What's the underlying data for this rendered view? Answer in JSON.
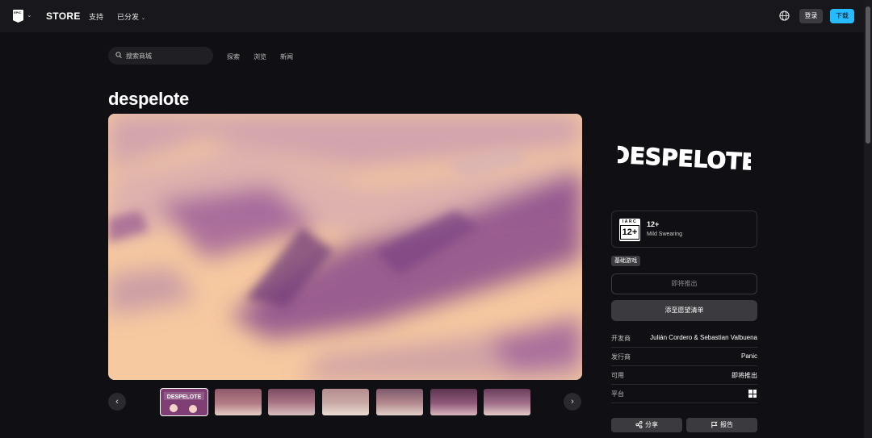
{
  "topnav": {
    "logo_text": "EPIC",
    "store_label": "STORE",
    "support_label": "支持",
    "distribute_label": "已分发",
    "login_label": "登录",
    "download_label": "下载"
  },
  "subnav": {
    "search_placeholder": "搜索商城",
    "links": [
      "探索",
      "浏览",
      "新闻"
    ]
  },
  "game": {
    "title": "despelote",
    "logo_text": "DESPELOTE",
    "rating": {
      "board": "IARC",
      "age": "12+",
      "descriptor": "Mild Swearing"
    },
    "base_badge": "基础游戏",
    "coming_soon_label": "即将推出",
    "wishlist_label": "添至愿望清单",
    "info": [
      {
        "key": "开发商",
        "value": "Julián Cordero & Sebastian Valbuena"
      },
      {
        "key": "发行商",
        "value": "Panic"
      },
      {
        "key": "可用",
        "value": "即将推出"
      },
      {
        "key": "平台",
        "value": "windows-icon"
      }
    ],
    "share_label": "分享",
    "report_label": "报告"
  },
  "carousel": {
    "thumbnails": [
      "thumb-1",
      "thumb-2",
      "thumb-3",
      "thumb-4",
      "thumb-5",
      "thumb-6",
      "thumb-7"
    ],
    "active_index": 0
  },
  "colors": {
    "background": "#101014",
    "nav": "#18181c",
    "accent": "#26bbff",
    "button": "#3a3a3f",
    "hero_peach": "#f6c9a0",
    "hero_purple": "#8a4a8c"
  }
}
